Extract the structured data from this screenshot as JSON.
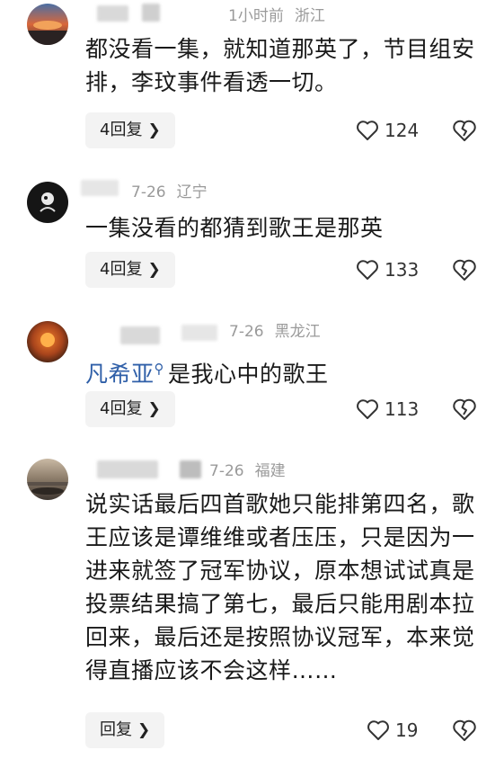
{
  "comments": [
    {
      "time": "1小时前",
      "location": "浙江",
      "text": "都没看一集，就知道那英了，节目组安排，李玟事件看透一切。",
      "reply_label": "4回复",
      "likes": "124"
    },
    {
      "time": "7-26",
      "location": "辽宁",
      "text": "一集没看的都猜到歌王是那英",
      "reply_label": "4回复",
      "likes": "133"
    },
    {
      "time": "7-26",
      "location": "黑龙江",
      "mention": "凡希亚",
      "text": "是我心中的歌王",
      "reply_label": "4回复",
      "likes": "113"
    },
    {
      "time": "7-26",
      "location": "福建",
      "text": "说实话最后四首歌她只能排第四名，歌王应该是谭维维或者压压，只是因为一进来就签了冠军协议，原本想试试真是投票结果搞了第七，最后只能用剧本拉回来，最后还是按照协议冠军，本来觉得直播应该不会这样……",
      "reply_label": "回复",
      "likes": "19"
    }
  ],
  "icons": {
    "like": "heart-outline-icon",
    "dislike": "broken-heart-icon",
    "reply_chevron": "chevron-right-icon",
    "mention": "search-icon"
  },
  "colors": {
    "mention": "#2f5fa8",
    "meta_text": "#9a9a9a",
    "reply_bg": "#f3f3f3"
  }
}
